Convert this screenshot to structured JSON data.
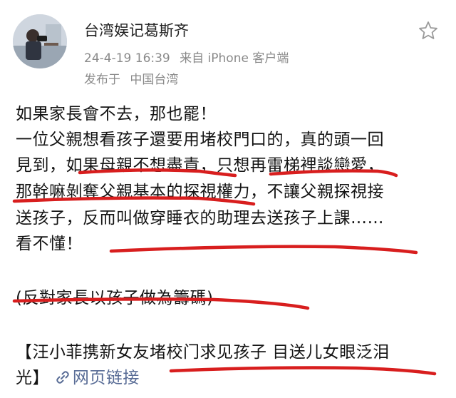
{
  "author": {
    "name": "台湾娱记葛斯齐",
    "time": "24-4-19 16:39",
    "source": "来自 iPhone 客户端",
    "location_label": "发布于",
    "location": "中国台湾"
  },
  "post": {
    "line1": "如果家長會不去，那也罷！",
    "line2": "一位父親想看孩子還要用堵校門口的，真的頭一回",
    "line3": "見到，如果母親不想盡責，只想再雷梯裡談戀愛，",
    "line4": "那幹嘛剝奪父親基本的探視權力，不讓父親探視接",
    "line5": "送孩子，反而叫做穿睡衣的助理去送孩子上課……",
    "line6": "看不懂！",
    "line7": "(反對家長以孩子做為籌碼)",
    "line8": "【汪小菲携新女友堵校门求见孩子 目送儿女眼泛泪",
    "line9_prefix": "光】",
    "link_label": "网页链接"
  },
  "colors": {
    "link": "#576b95",
    "annotation": "#d81e1e",
    "meta_gray": "#8a8a8a"
  },
  "icons": {
    "favorite": "star-outline-icon",
    "link": "link-icon"
  }
}
